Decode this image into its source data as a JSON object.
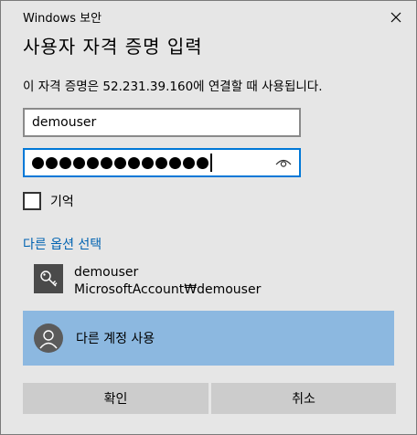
{
  "window": {
    "title": "Windows 보안"
  },
  "dialog": {
    "heading": "사용자 자격 증명 입력",
    "message": "이 자격 증명은 52.231.39.160에 연결할 때 사용됩니다.",
    "username_value": "demouser",
    "password_mask_count": 13,
    "remember_label": "기억",
    "remember_checked": false,
    "more_options_label": "다른 옵션 선택",
    "account": {
      "name": "demouser",
      "domain": "MicrosoftAccount₩demouser"
    },
    "other_account_label": "다른 계정 사용",
    "ok_label": "확인",
    "cancel_label": "취소"
  },
  "colors": {
    "background": "#e6e6e6",
    "focus_border": "#0078d7",
    "link": "#0063b1",
    "selected_item": "#8cb8e0",
    "button": "#cccccc"
  },
  "icons": {
    "close": "close-icon",
    "eye": "eye-icon",
    "key": "key-icon",
    "avatar": "user-avatar-icon"
  }
}
